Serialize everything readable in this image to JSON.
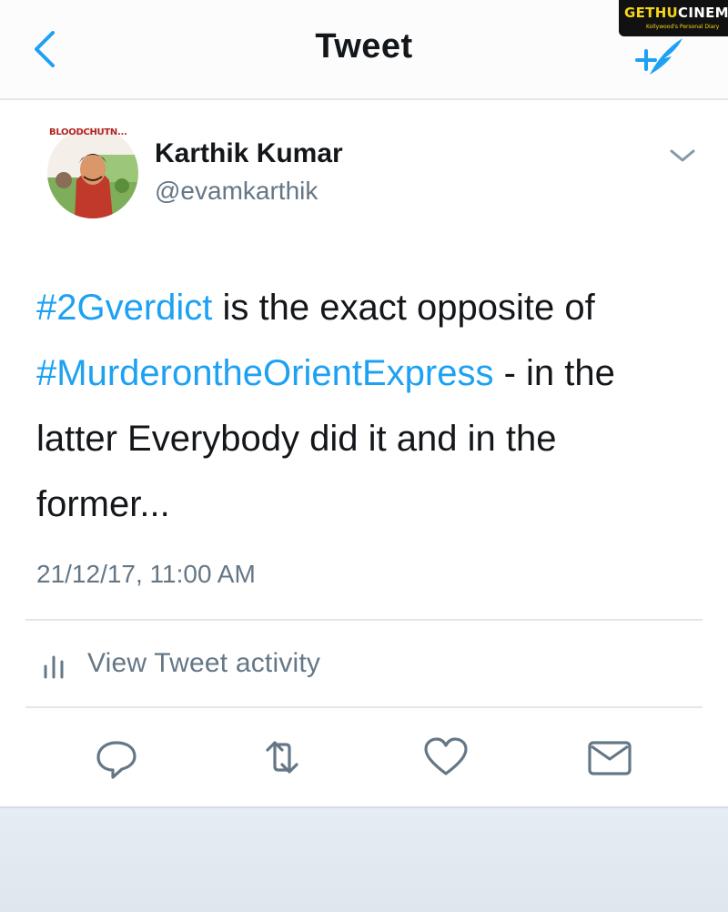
{
  "navbar": {
    "title": "Tweet",
    "back_icon": "chevron-left-icon",
    "compose_icon": "compose-tweet-icon",
    "accent_color": "#1da1f2"
  },
  "watermark": {
    "text_yellow": "GETHU",
    "text_white": "CINEMA",
    "subtext": "Kollywood's Personal Diary"
  },
  "tweet": {
    "author": {
      "name": "Karthik Kumar",
      "handle": "@evamkarthik",
      "avatar_caption": "BLOODCHUTN..."
    },
    "text": {
      "hashtag1": "#2Gverdict",
      "part1": " is the exact opposite of ",
      "hashtag2": "#MurderontheOrientExpress",
      "part2": " - in the latter Everybody did it and in the former..."
    },
    "timestamp": "21/12/17, 11:00 AM",
    "activity_label": "View Tweet activity",
    "hashtag_color": "#1da1f2"
  },
  "actions": [
    {
      "name": "reply",
      "icon": "reply-icon"
    },
    {
      "name": "retweet",
      "icon": "retweet-icon"
    },
    {
      "name": "like",
      "icon": "heart-icon"
    },
    {
      "name": "share",
      "icon": "envelope-icon"
    }
  ]
}
